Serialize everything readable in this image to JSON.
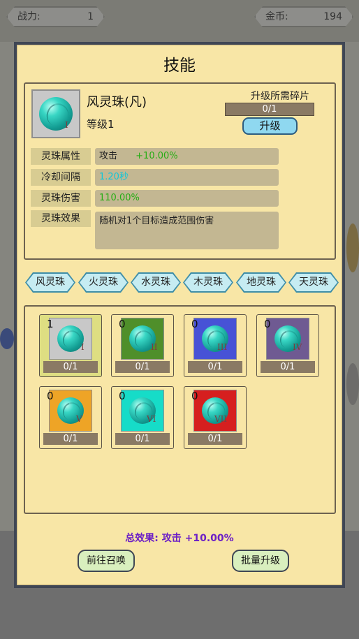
{
  "hud": {
    "power_label": "战力:",
    "power_value": "1",
    "gold_label": "金币:",
    "gold_value": "194"
  },
  "dialog": {
    "title": "技能",
    "selected": {
      "name": "风灵珠(凡)",
      "level": "等级1",
      "numeral": "I",
      "required_label": "升级所需碎片",
      "required_progress": "0/1",
      "upgrade_label": "升级"
    },
    "attributes": [
      {
        "label": "灵珠属性",
        "key": "攻击",
        "value": "+10.00%"
      },
      {
        "label": "冷却间隔",
        "value": "1.20秒"
      },
      {
        "label": "灵珠伤害",
        "value": "110.00%"
      }
    ],
    "effect_label": "灵珠效果",
    "effect_text": "随机对1个目标造成范围伤害",
    "tabs": [
      "风灵珠",
      "火灵珠",
      "水灵珠",
      "木灵珠",
      "地灵珠",
      "天灵珠"
    ],
    "orbs": [
      {
        "count": "1",
        "numeral": "I",
        "progress": "0/1",
        "bg": "#c8c8c8"
      },
      {
        "count": "0",
        "numeral": "II",
        "progress": "0/1",
        "bg": "#4f8f2a"
      },
      {
        "count": "0",
        "numeral": "III",
        "progress": "0/1",
        "bg": "#4752d6"
      },
      {
        "count": "0",
        "numeral": "IV",
        "progress": "0/1",
        "bg": "#6f5a92"
      },
      {
        "count": "0",
        "numeral": "V",
        "progress": "0/1",
        "bg": "#eea426"
      },
      {
        "count": "0",
        "numeral": "VI",
        "progress": "0/1",
        "bg": "#16dcc8"
      },
      {
        "count": "0",
        "numeral": "VII",
        "progress": "0/1",
        "bg": "#d61f1f"
      }
    ],
    "total_effect": "总效果: 攻击 +10.00%",
    "summon_label": "前往召唤",
    "batch_upgrade_label": "批量升级"
  }
}
